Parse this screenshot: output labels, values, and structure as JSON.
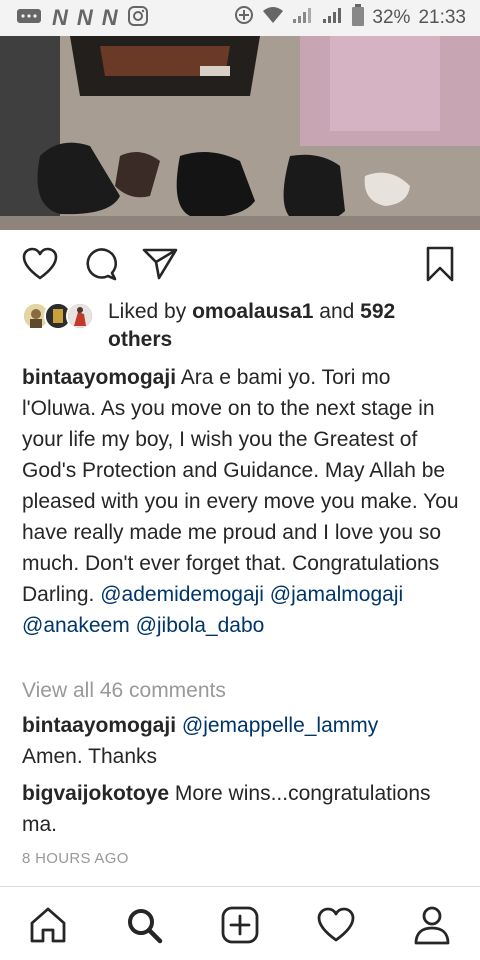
{
  "status_bar": {
    "battery": "32%",
    "time": "21:33",
    "notification_glyphs": [
      "N",
      "N",
      "N"
    ]
  },
  "post": {
    "liked_by_prefix": "Liked by ",
    "liked_by_user": "omoalausa1",
    "liked_by_and": " and ",
    "liked_by_others": "592 others",
    "caption_user": "bintaayomogaji",
    "caption_text": "Ara e bami yo. Tori mo l'Oluwa. As you move on to the next stage in your life my boy, I wish you the Greatest of God's Protection and Guidance. May Allah be pleased with you in every move you make. You have really made me proud and I love you so much. Don't ever forget that. Congratulations Darling.",
    "mentions": [
      "@ademidemogaji",
      "@jamalmogaji",
      "@anakeem",
      "@jibola_dabo"
    ],
    "view_comments": "View all 46 comments",
    "comments": [
      {
        "user": "bintaayomogaji",
        "mention": "@jemappelle_lammy",
        "text": "Amen. Thanks"
      },
      {
        "user": "bigvaijokotoye",
        "text": "More wins...congratulations ma."
      }
    ],
    "time_ago": "8 HOURS AGO"
  },
  "icons": {
    "status": [
      "screen-icon",
      "notification-icon",
      "instagram-icon",
      "data-saver-icon",
      "wifi-icon",
      "signal-icon",
      "battery-icon"
    ],
    "actions": [
      "heart-icon",
      "comment-icon",
      "share-icon",
      "bookmark-icon"
    ],
    "nav": [
      "home-icon",
      "search-icon",
      "add-icon",
      "activity-icon",
      "profile-icon"
    ]
  },
  "colors": {
    "mention": "#003569",
    "muted": "#999999",
    "text": "#262626"
  }
}
